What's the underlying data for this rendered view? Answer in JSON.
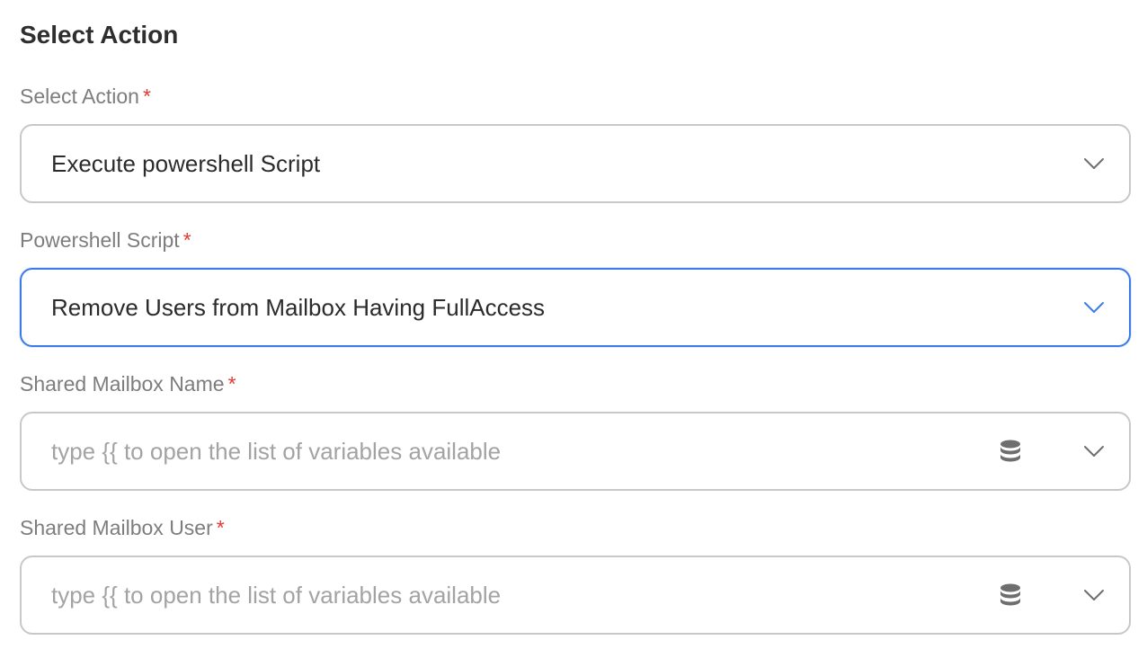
{
  "section": {
    "title": "Select Action"
  },
  "fields": {
    "action": {
      "label": "Select Action",
      "required_mark": "*",
      "value": "Execute powershell Script"
    },
    "script": {
      "label": "Powershell Script",
      "required_mark": "*",
      "value": "Remove Users from Mailbox Having FullAccess"
    },
    "mailbox_name": {
      "label": "Shared Mailbox Name",
      "required_mark": "*",
      "value": "",
      "placeholder": "type {{ to open the list of variables available"
    },
    "mailbox_user": {
      "label": "Shared Mailbox User",
      "required_mark": "*",
      "value": "",
      "placeholder": "type {{ to open the list of variables available"
    }
  },
  "icons": {
    "dropdown": "chevron-down-icon",
    "variables": "database-icon"
  },
  "colors": {
    "focus_border": "#3b7ce8",
    "required": "#e53935",
    "label": "#7d7d7d",
    "placeholder": "#a3a3a3"
  }
}
